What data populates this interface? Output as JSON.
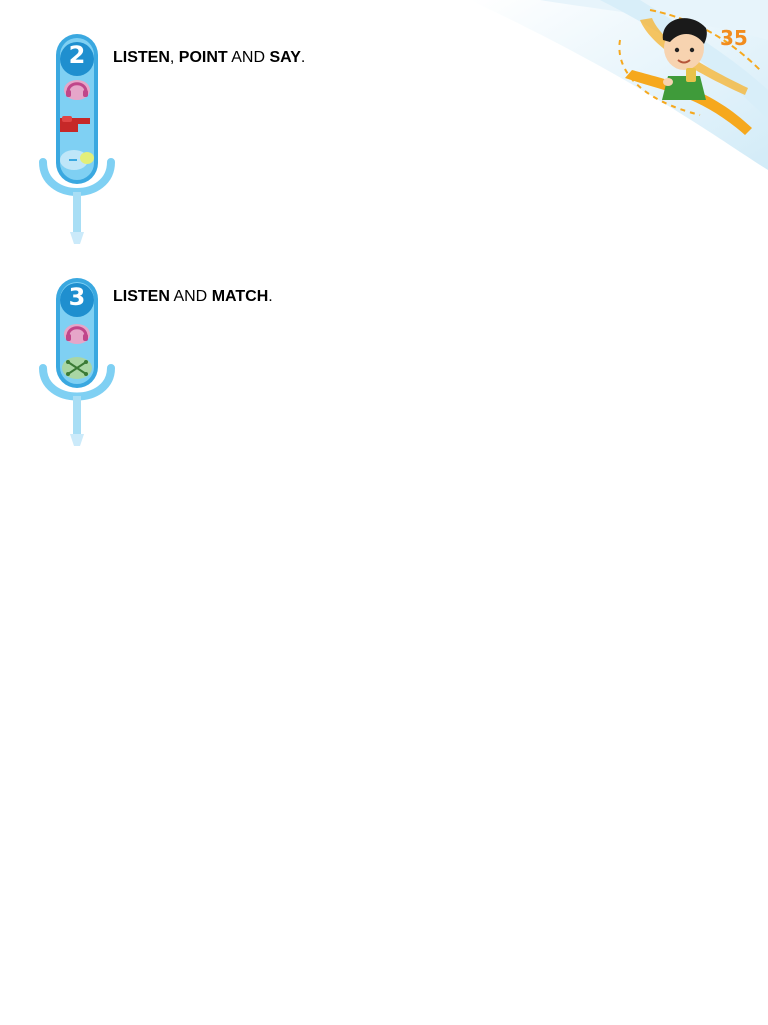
{
  "page": {
    "number": "35",
    "colors": {
      "accent_orange": "#f28c1e",
      "mic_blue": "#3aa8e0",
      "listen_pink": "#c0468a",
      "point_red": "#c62828",
      "match_green": "#6fae6a"
    }
  },
  "exercises": [
    {
      "number": "2",
      "icons": [
        "headphones-icon",
        "pointing-hand-icon",
        "speech-bubble-icon"
      ],
      "instruction": [
        {
          "text": "LISTEN",
          "bold": true
        },
        {
          "text": ", ",
          "bold": false
        },
        {
          "text": "POINT",
          "bold": true
        },
        {
          "text": " AND ",
          "bold": false
        },
        {
          "text": "SAY",
          "bold": true
        },
        {
          "text": ".",
          "bold": false
        }
      ]
    },
    {
      "number": "3",
      "icons": [
        "headphones-icon",
        "match-lines-icon"
      ],
      "instruction": [
        {
          "text": "LISTEN",
          "bold": true
        },
        {
          "text": " AND ",
          "bold": false
        },
        {
          "text": "MATCH",
          "bold": true
        },
        {
          "text": ".",
          "bold": false
        }
      ]
    }
  ]
}
